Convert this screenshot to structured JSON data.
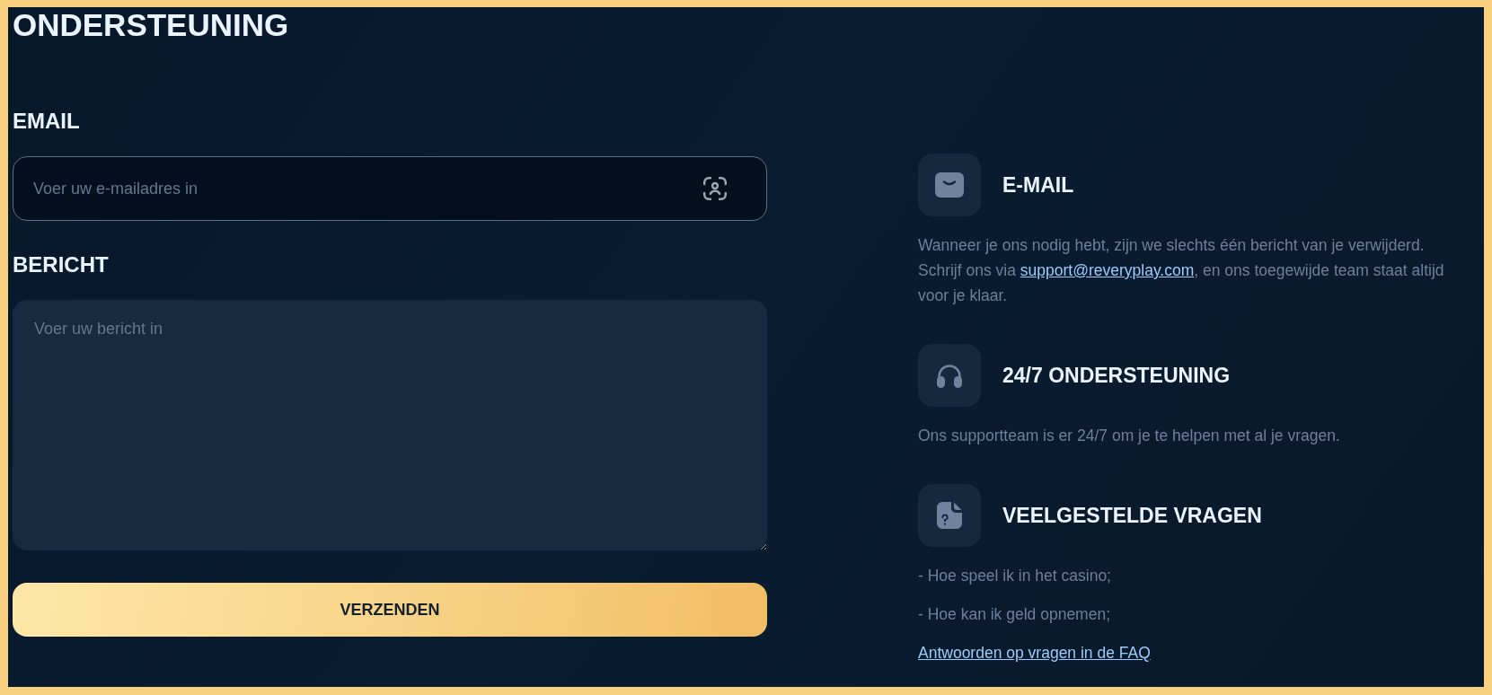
{
  "page": {
    "title": "ONDERSTEUNING"
  },
  "form": {
    "fields": [
      {
        "kind": "input",
        "label": "EMAIL",
        "placeholder": "Voer uw e-mailadres in"
      },
      {
        "kind": "textarea",
        "label": "BERICHT",
        "placeholder": "Voer uw bericht in"
      }
    ],
    "submit": "VERZENDEN"
  },
  "contacts": [
    {
      "kind": "email",
      "title": "E-MAIL",
      "blocks": [
        {
          "kind": "paragraph",
          "segments": [
            {
              "kind": "text",
              "text": "Wanneer je ons nodig hebt, zijn we slechts één bericht van je verwijderd. Schrijf ons via "
            },
            {
              "kind": "link",
              "text": "support@reveryplay.com"
            },
            {
              "kind": "text",
              "text": ", en ons toegewijde team staat altijd voor je klaar."
            }
          ]
        }
      ]
    },
    {
      "kind": "support",
      "title": "24/7 ONDERSTEUNING",
      "blocks": [
        {
          "kind": "paragraph",
          "segments": [
            {
              "kind": "text",
              "text": "Ons supportteam is er 24/7 om je te helpen met al je vragen."
            }
          ]
        }
      ]
    },
    {
      "kind": "faq",
      "title": "VEELGESTELDE VRAGEN",
      "blocks": [
        {
          "kind": "paragraph",
          "segments": [
            {
              "kind": "text",
              "text": "- Hoe speel ik in het casino;"
            }
          ]
        },
        {
          "kind": "paragraph",
          "segments": [
            {
              "kind": "text",
              "text": "- Hoe kan ik geld opnemen;"
            }
          ]
        },
        {
          "kind": "link",
          "text": "Antwoorden op vragen in de FAQ"
        }
      ]
    }
  ]
}
